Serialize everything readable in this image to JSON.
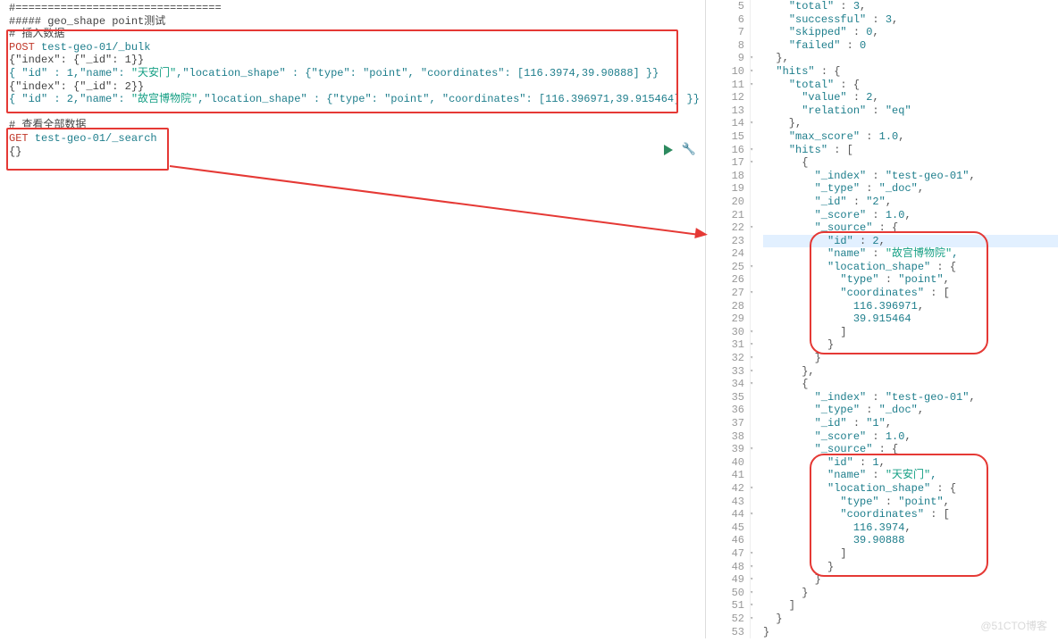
{
  "left": {
    "line1": "#================================",
    "line2": "##### geo_shape point测试",
    "insert_comment": "# 插入数据",
    "post_kw": "POST",
    "post_url": " test-geo-01/_bulk",
    "bulk1": "{\"index\": {\"_id\": 1}}",
    "bulk2_a": "{ \"id\" : 1,\"name\": ",
    "bulk2_name": "\"天安门\"",
    "bulk2_b": ",\"location_shape\" : {\"type\": \"point\", \"coordinates\": [116.3974,39.90888] }}",
    "bulk3": "{\"index\": {\"_id\": 2}}",
    "bulk4_a": "{ \"id\" : 2,\"name\": ",
    "bulk4_name": "\"故宫博物院\"",
    "bulk4_b": ",\"location_shape\" : {\"type\": \"point\", \"coordinates\": [116.396971,39.915464] }}",
    "query_comment": "# 查看全部数据",
    "get_kw": "GET",
    "get_url": " test-geo-01/_search",
    "empty_body": "{}"
  },
  "right": {
    "lines": [
      {
        "no": 5,
        "txt": "    \"total\" : 3,"
      },
      {
        "no": 6,
        "txt": "    \"successful\" : 3,"
      },
      {
        "no": 7,
        "txt": "    \"skipped\" : 0,"
      },
      {
        "no": 8,
        "txt": "    \"failed\" : 0"
      },
      {
        "no": 9,
        "fold": true,
        "txt": "  },"
      },
      {
        "no": 10,
        "fold": true,
        "txt": "  \"hits\" : {"
      },
      {
        "no": 11,
        "fold": true,
        "txt": "    \"total\" : {"
      },
      {
        "no": 12,
        "txt": "      \"value\" : 2,"
      },
      {
        "no": 13,
        "txt": "      \"relation\" : \"eq\""
      },
      {
        "no": 14,
        "fold": true,
        "txt": "    },"
      },
      {
        "no": 15,
        "txt": "    \"max_score\" : 1.0,"
      },
      {
        "no": 16,
        "fold": true,
        "txt": "    \"hits\" : ["
      },
      {
        "no": 17,
        "fold": true,
        "txt": "      {"
      },
      {
        "no": 18,
        "txt": "        \"_index\" : \"test-geo-01\","
      },
      {
        "no": 19,
        "txt": "        \"_type\" : \"_doc\","
      },
      {
        "no": 20,
        "txt": "        \"_id\" : \"2\","
      },
      {
        "no": 21,
        "txt": "        \"_score\" : 1.0,"
      },
      {
        "no": 22,
        "fold": true,
        "txt": "        \"_source\" : {"
      },
      {
        "no": 23,
        "hl": true,
        "txt": "          \"id\" : 2,"
      },
      {
        "no": 24,
        "grn": "\"故宫博物院\"",
        "txt": "          \"name\" : "
      },
      {
        "no": 25,
        "fold": true,
        "txt": "          \"location_shape\" : {"
      },
      {
        "no": 26,
        "txt": "            \"type\" : \"point\","
      },
      {
        "no": 27,
        "fold": true,
        "txt": "            \"coordinates\" : ["
      },
      {
        "no": 28,
        "txt": "              116.396971,"
      },
      {
        "no": 29,
        "txt": "              39.915464"
      },
      {
        "no": 30,
        "fold": true,
        "txt": "            ]"
      },
      {
        "no": 31,
        "fold": true,
        "txt": "          }"
      },
      {
        "no": 32,
        "fold": true,
        "txt": "        }"
      },
      {
        "no": 33,
        "fold": true,
        "txt": "      },"
      },
      {
        "no": 34,
        "fold": true,
        "txt": "      {"
      },
      {
        "no": 35,
        "txt": "        \"_index\" : \"test-geo-01\","
      },
      {
        "no": 36,
        "txt": "        \"_type\" : \"_doc\","
      },
      {
        "no": 37,
        "txt": "        \"_id\" : \"1\","
      },
      {
        "no": 38,
        "txt": "        \"_score\" : 1.0,"
      },
      {
        "no": 39,
        "fold": true,
        "txt": "        \"_source\" : {"
      },
      {
        "no": 40,
        "txt": "          \"id\" : 1,"
      },
      {
        "no": 41,
        "grn": "\"天安门\"",
        "txt": "          \"name\" : "
      },
      {
        "no": 42,
        "fold": true,
        "txt": "          \"location_shape\" : {"
      },
      {
        "no": 43,
        "txt": "            \"type\" : \"point\","
      },
      {
        "no": 44,
        "fold": true,
        "txt": "            \"coordinates\" : ["
      },
      {
        "no": 45,
        "txt": "              116.3974,"
      },
      {
        "no": 46,
        "txt": "              39.90888"
      },
      {
        "no": 47,
        "fold": true,
        "txt": "            ]"
      },
      {
        "no": 48,
        "fold": true,
        "txt": "          }"
      },
      {
        "no": 49,
        "fold": true,
        "txt": "        }"
      },
      {
        "no": 50,
        "fold": true,
        "txt": "      }"
      },
      {
        "no": 51,
        "fold": true,
        "txt": "    ]"
      },
      {
        "no": 52,
        "fold": true,
        "txt": "  }"
      },
      {
        "no": 53,
        "txt": "}"
      }
    ]
  },
  "watermark": "@51CTO博客"
}
